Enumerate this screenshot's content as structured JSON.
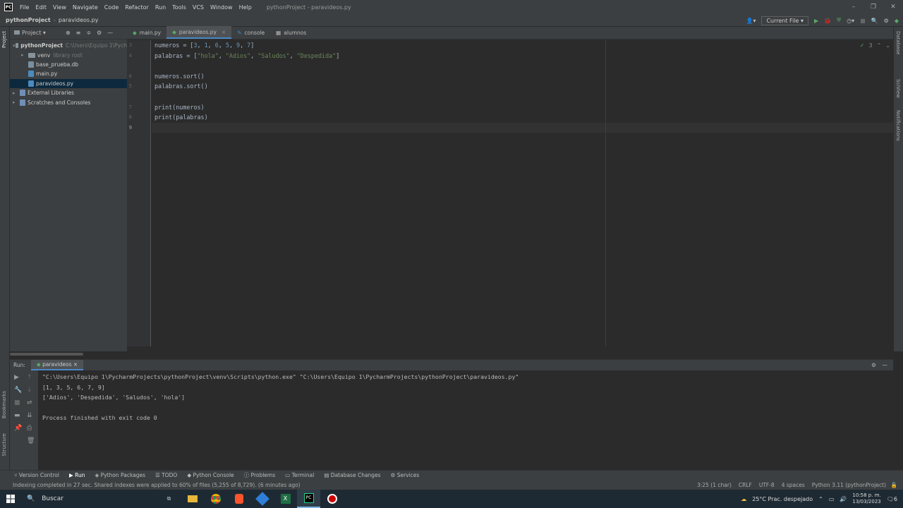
{
  "titlebar": {
    "menu": [
      "File",
      "Edit",
      "View",
      "Navigate",
      "Code",
      "Refactor",
      "Run",
      "Tools",
      "VCS",
      "Window",
      "Help"
    ],
    "title": "pythonProject - paravideos.py"
  },
  "navbar": {
    "project": "pythonProject",
    "file": "paravideos.py",
    "run_config": "Current File"
  },
  "project_panel": {
    "title": "Project",
    "items": [
      {
        "label": "pythonProject",
        "extra": "C:\\Users\\Equipo 1\\Pych",
        "depth": 0,
        "kind": "folder",
        "arrow": "▾"
      },
      {
        "label": "venv",
        "extra": "library root",
        "depth": 1,
        "kind": "folder",
        "arrow": "▸"
      },
      {
        "label": "base_prueba.db",
        "extra": "",
        "depth": 1,
        "kind": "db",
        "arrow": ""
      },
      {
        "label": "main.py",
        "extra": "",
        "depth": 1,
        "kind": "py",
        "arrow": ""
      },
      {
        "label": "paravideos.py",
        "extra": "",
        "depth": 1,
        "kind": "py",
        "arrow": "",
        "selected": true
      },
      {
        "label": "External Libraries",
        "extra": "",
        "depth": 0,
        "kind": "lib",
        "arrow": "▸"
      },
      {
        "label": "Scratches and Consoles",
        "extra": "",
        "depth": 0,
        "kind": "scratch",
        "arrow": "▸"
      }
    ]
  },
  "tabs": [
    {
      "label": "main.py",
      "active": false
    },
    {
      "label": "paravideos.py",
      "active": true
    },
    {
      "label": "console",
      "active": false
    },
    {
      "label": "alumnos",
      "active": false
    }
  ],
  "editor": {
    "line_numbers": [
      "3",
      "4",
      "",
      "6",
      "5",
      "",
      "7",
      "8",
      "9"
    ],
    "lines": [
      "numeros = [3, 1, 6, 5, 9, 7]",
      "palabras = [\"hola\", \"Adios\", \"Saludos\", \"Despedida\"]",
      "",
      "numeros.sort()",
      "palabras.sort()",
      "",
      "print(numeros)",
      "print(palabras)",
      ""
    ],
    "inspections": "3"
  },
  "run_panel": {
    "label": "Run:",
    "tab": "paravideos",
    "output": [
      "\"C:\\Users\\Equipo 1\\PycharmProjects\\pythonProject\\venv\\Scripts\\python.exe\" \"C:\\Users\\Equipo 1\\PycharmProjects\\pythonProject\\paravideos.py\"",
      "[1, 3, 5, 6, 7, 9]",
      "['Adios', 'Despedida', 'Saludos', 'hola']",
      "",
      "Process finished with exit code 0"
    ]
  },
  "toolwindows": [
    "Version Control",
    "Run",
    "Python Packages",
    "TODO",
    "Python Console",
    "Problems",
    "Terminal",
    "Database Changes",
    "Services"
  ],
  "statusbar": {
    "message": "Indexing completed in 27 sec. Shared indexes were applied to 60% of files (5,255 of 8,729). (6 minutes ago)",
    "position": "3:25 (1 char)",
    "line_sep": "CRLF",
    "encoding": "UTF-8",
    "indent": "4 spaces",
    "interpreter": "Python 3.11 (pythonProject)"
  },
  "side_labels": {
    "left": [
      "Project",
      "Bookmarks",
      "Structure"
    ],
    "right": [
      "Database",
      "SciView",
      "Notifications"
    ]
  },
  "taskbar": {
    "search": "Buscar",
    "weather": "25°C  Prac. despejado",
    "time": "10:58 p. m.",
    "date": "13/03/2023",
    "notif": "6"
  },
  "colors": {
    "accent": "#4a88c7",
    "run_green": "#59a869",
    "string": "#6a8759",
    "number": "#6897bb"
  }
}
